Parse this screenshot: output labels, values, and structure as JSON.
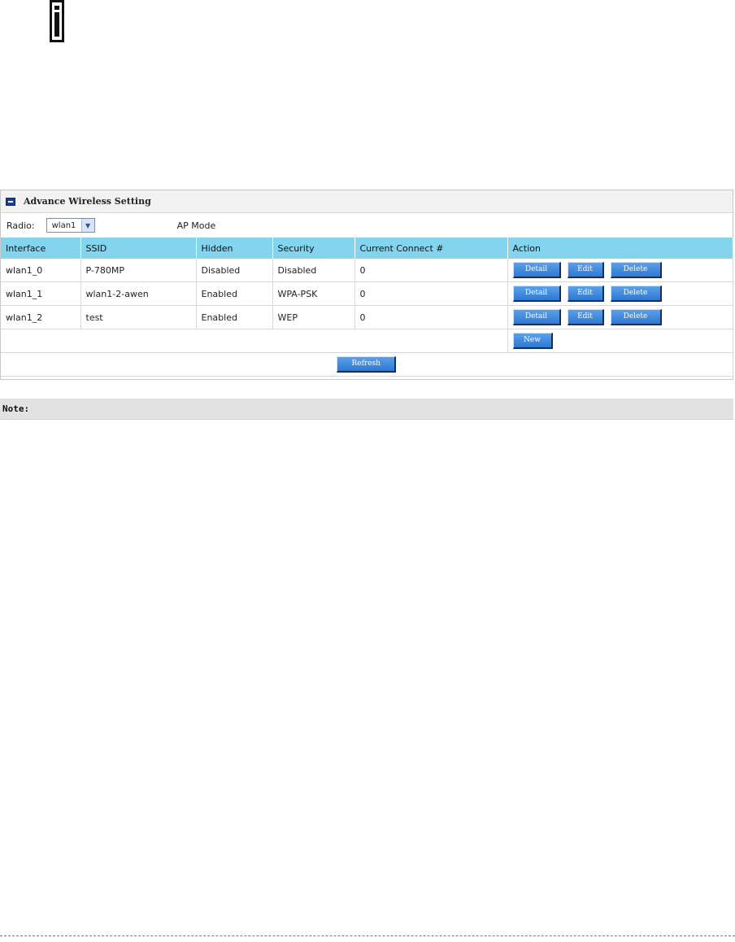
{
  "panel": {
    "title": "Advance Wireless Setting",
    "radio_label": "Radio:",
    "radio_value": "wlan1",
    "mode_text": "AP Mode"
  },
  "table": {
    "headers": [
      "Interface",
      "SSID",
      "Hidden",
      "Security",
      "Current Connect #",
      "Action"
    ],
    "rows": [
      {
        "interface": "wlan1_0",
        "ssid": "P-780MP",
        "hidden": "Disabled",
        "security": "Disabled",
        "connect": "0"
      },
      {
        "interface": "wlan1_1",
        "ssid": "wlan1-2-awen",
        "hidden": "Enabled",
        "security": "WPA-PSK",
        "connect": "0"
      },
      {
        "interface": "wlan1_2",
        "ssid": "test",
        "hidden": "Enabled",
        "security": "WEP",
        "connect": "0"
      }
    ]
  },
  "buttons": {
    "detail": "Detail",
    "edit": "Edit",
    "delete": "Delete",
    "new": "New",
    "refresh": "Refresh"
  },
  "note": {
    "label": "Note:"
  },
  "colors": {
    "header_bg": "#84d4ee",
    "button_bg": "#3f8ae0",
    "note_bg": "#e2e2e2"
  },
  "icons": {
    "top": "info-icon",
    "title": "arrow-box-icon",
    "select": "chevron-down-icon"
  }
}
